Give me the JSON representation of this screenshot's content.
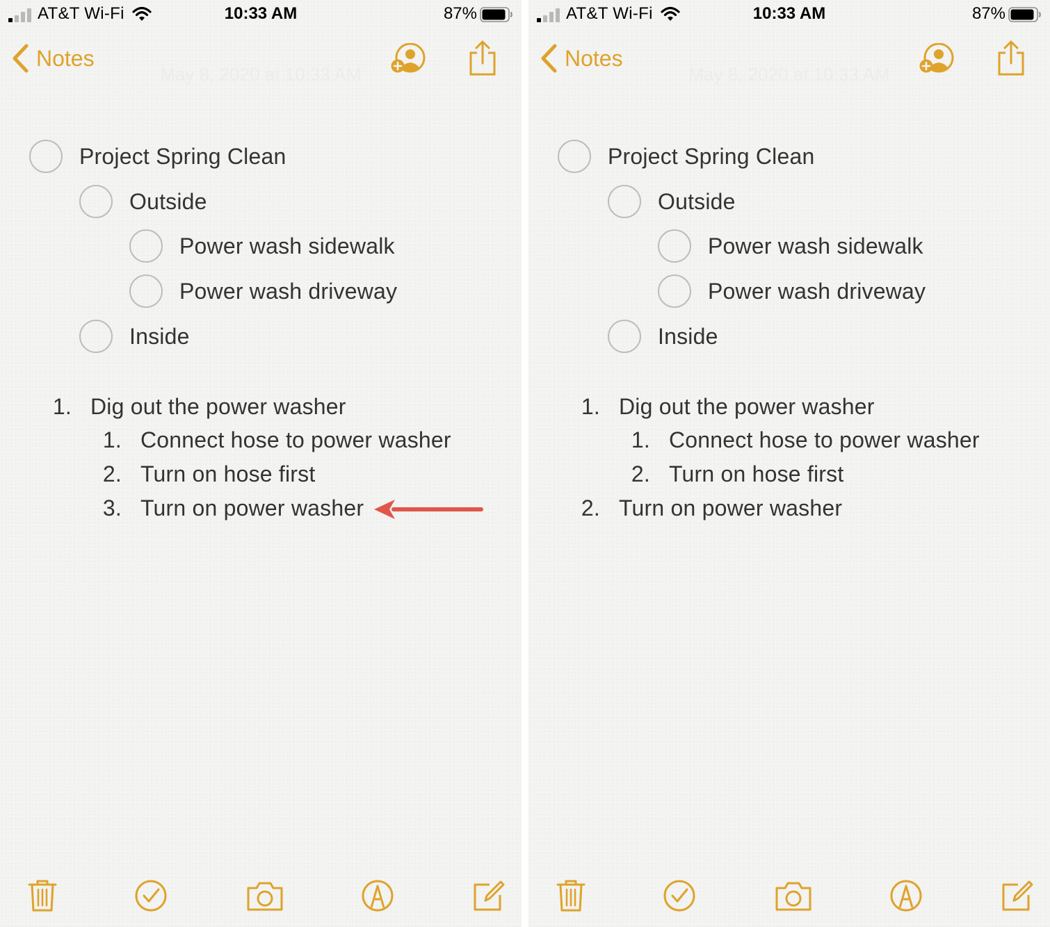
{
  "colors": {
    "accent": "#dea32c",
    "text": "#333333",
    "circle": "#bdbdbd",
    "annotation_arrow": "#e0564a",
    "background": "#f3f3f1"
  },
  "status_bar": {
    "carrier": "AT&T Wi-Fi",
    "time": "10:33 AM",
    "battery": "87%"
  },
  "nav": {
    "back_label": "Notes",
    "date": "May 8, 2020 at 10:33 AM"
  },
  "icons": {
    "nav": [
      "chevron-left-icon",
      "add-person-icon",
      "share-icon"
    ],
    "toolbar": [
      "trash-icon",
      "checklist-icon",
      "camera-icon",
      "markup-icon",
      "compose-icon"
    ]
  },
  "left": {
    "checklist": [
      {
        "text": "Project Spring Clean",
        "level": 0
      },
      {
        "text": "Outside",
        "level": 1
      },
      {
        "text": "Power wash sidewalk",
        "level": 2
      },
      {
        "text": "Power wash driveway",
        "level": 2
      },
      {
        "text": "Inside",
        "level": 1
      }
    ],
    "numbered": [
      {
        "num": "1.",
        "text": "Dig out the power washer",
        "level": 0
      },
      {
        "num": "1.",
        "text": "Connect hose to power washer",
        "level": 1
      },
      {
        "num": "2.",
        "text": "Turn on hose first",
        "level": 1
      },
      {
        "num": "3.",
        "text": "Turn on power washer",
        "level": 1
      }
    ]
  },
  "right": {
    "checklist": [
      {
        "text": "Project Spring Clean",
        "level": 0
      },
      {
        "text": "Outside",
        "level": 1
      },
      {
        "text": "Power wash sidewalk",
        "level": 2
      },
      {
        "text": "Power wash driveway",
        "level": 2
      },
      {
        "text": "Inside",
        "level": 1
      }
    ],
    "numbered": [
      {
        "num": "1.",
        "text": "Dig out the power washer",
        "level": 0
      },
      {
        "num": "1.",
        "text": "Connect hose to power washer",
        "level": 1
      },
      {
        "num": "2.",
        "text": "Turn on hose first",
        "level": 1
      },
      {
        "num": "2.",
        "text": "Turn on power washer",
        "level": 0
      }
    ]
  }
}
